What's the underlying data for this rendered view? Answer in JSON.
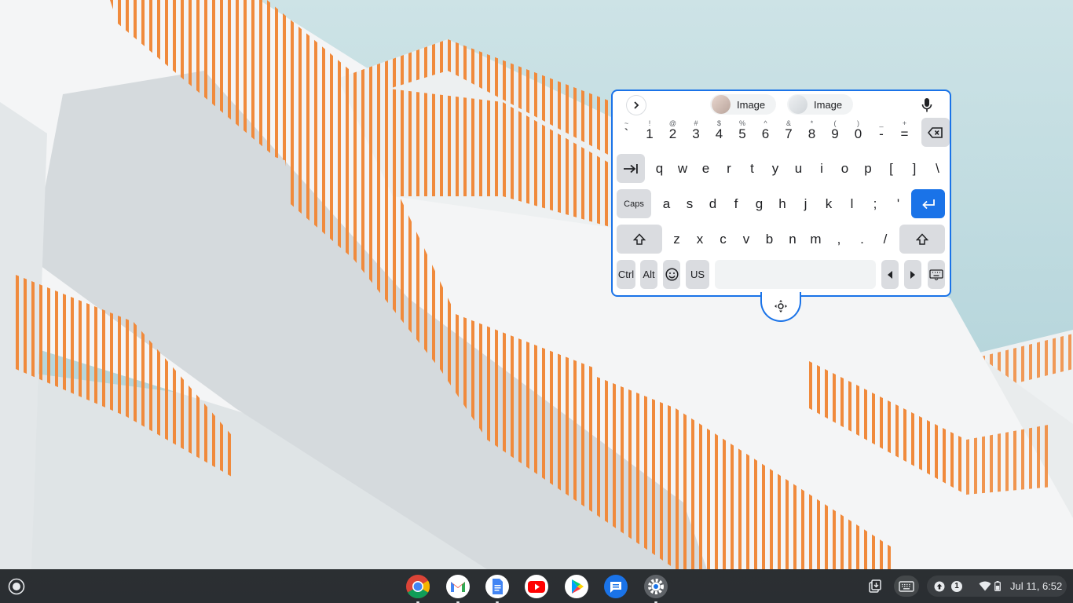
{
  "keyboard": {
    "suggestions": [
      {
        "label": "Image"
      },
      {
        "label": "Image"
      }
    ],
    "row_numbers": [
      {
        "sup": "~",
        "main": "`"
      },
      {
        "sup": "!",
        "main": "1"
      },
      {
        "sup": "@",
        "main": "2"
      },
      {
        "sup": "#",
        "main": "3"
      },
      {
        "sup": "$",
        "main": "4"
      },
      {
        "sup": "%",
        "main": "5"
      },
      {
        "sup": "^",
        "main": "6"
      },
      {
        "sup": "&",
        "main": "7"
      },
      {
        "sup": "*",
        "main": "8"
      },
      {
        "sup": "(",
        "main": "9"
      },
      {
        "sup": ")",
        "main": "0"
      },
      {
        "sup": "_",
        "main": "-"
      },
      {
        "sup": "+",
        "main": "="
      }
    ],
    "row_q": [
      "q",
      "w",
      "e",
      "r",
      "t",
      "y",
      "u",
      "i",
      "o",
      "p",
      "[",
      "]",
      "\\"
    ],
    "row_a": [
      "a",
      "s",
      "d",
      "f",
      "g",
      "h",
      "j",
      "k",
      "l",
      ";",
      "'"
    ],
    "row_z": [
      "z",
      "x",
      "c",
      "v",
      "b",
      "n",
      "m",
      ",",
      ".",
      "/"
    ],
    "caps_label": "Caps",
    "ctrl_label": "Ctrl",
    "alt_label": "Alt",
    "layout_label": "US"
  },
  "shelf": {
    "apps": [
      "chrome-icon",
      "gmail-icon",
      "docs-icon",
      "youtube-icon",
      "play-store-icon",
      "messages-icon",
      "settings-icon"
    ],
    "notification_count": "1",
    "clock": "Jul 11, 6:52"
  },
  "colors": {
    "accent": "#1a73e8",
    "rail": "#f08a3c",
    "shelf": "#202124"
  }
}
